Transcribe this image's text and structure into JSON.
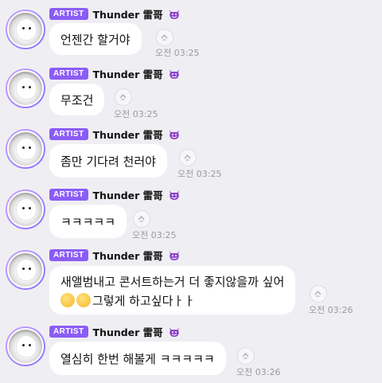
{
  "messages": [
    {
      "badge": "ARTIST",
      "sender": "Thunder 雷哥",
      "emoji_icon": "smiling-devil-emoji",
      "text": "언젠간 할거야",
      "time": "오전 03:25"
    },
    {
      "badge": "ARTIST",
      "sender": "Thunder 雷哥",
      "emoji_icon": "smiling-devil-emoji",
      "text": "무조건",
      "time": "오전 03:25"
    },
    {
      "badge": "ARTIST",
      "sender": "Thunder 雷哥",
      "emoji_icon": "smiling-devil-emoji",
      "text": "좀만 기다려 천러야",
      "time": "오전 03:25"
    },
    {
      "badge": "ARTIST",
      "sender": "Thunder 雷哥",
      "emoji_icon": "smiling-devil-emoji",
      "text": "ㅋㅋㅋㅋㅋ",
      "time": "오전 03:25"
    },
    {
      "badge": "ARTIST",
      "sender": "Thunder 雷哥",
      "emoji_icon": "smiling-devil-emoji",
      "text_line1": "새앨범내고 콘서트하는거 더 좋지않을까 싶어",
      "text_line2": "그렇게 하고싶다ㅏㅏ",
      "inline_emojis": [
        "shushing-face-emoji",
        "smirking-face-emoji"
      ],
      "time": "오전 03:26"
    },
    {
      "badge": "ARTIST",
      "sender": "Thunder 雷哥",
      "emoji_icon": "smiling-devil-emoji",
      "text": "열심히 한번 해볼게 ㅋㅋㅋㅋㅋ",
      "time": "오전 03:26"
    }
  ],
  "colors": {
    "background": "#efeff3",
    "badge": "#8b5cf6",
    "bubble": "#ffffff",
    "time": "#9a9a9a"
  }
}
